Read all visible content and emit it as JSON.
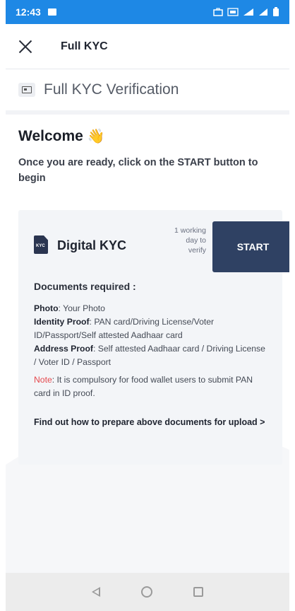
{
  "status_bar": {
    "time": "12:43"
  },
  "app_bar": {
    "title": "Full KYC"
  },
  "section": {
    "title": "Full KYC Verification"
  },
  "welcome": {
    "title": "Welcome",
    "emoji": "👋",
    "text": "Once you are ready, click on the START button to begin"
  },
  "digital_kyc": {
    "icon_text": "KYC",
    "title": "Digital KYC",
    "working_day": "1 working day to verify",
    "start_label": "START"
  },
  "documents": {
    "title": "Documents required :",
    "items": [
      {
        "label": "Photo",
        "value": ": Your Photo"
      },
      {
        "label": "Identity Proof",
        "value": ": PAN card/Driving License/Voter ID/Passport/Self attested Aadhaar card"
      },
      {
        "label": "Address Proof",
        "value": ": Self attested Aadhaar card / Driving License / Voter ID / Passport"
      }
    ],
    "note_label": "Note",
    "note_text": ": It is compulsory for food wallet users to submit PAN card in ID proof.",
    "prepare_link": "Find out how to prepare above documents for upload >"
  },
  "colors": {
    "status_bar": "#1e88e5",
    "start_button": "#2f4163",
    "note": "#e5484d"
  }
}
